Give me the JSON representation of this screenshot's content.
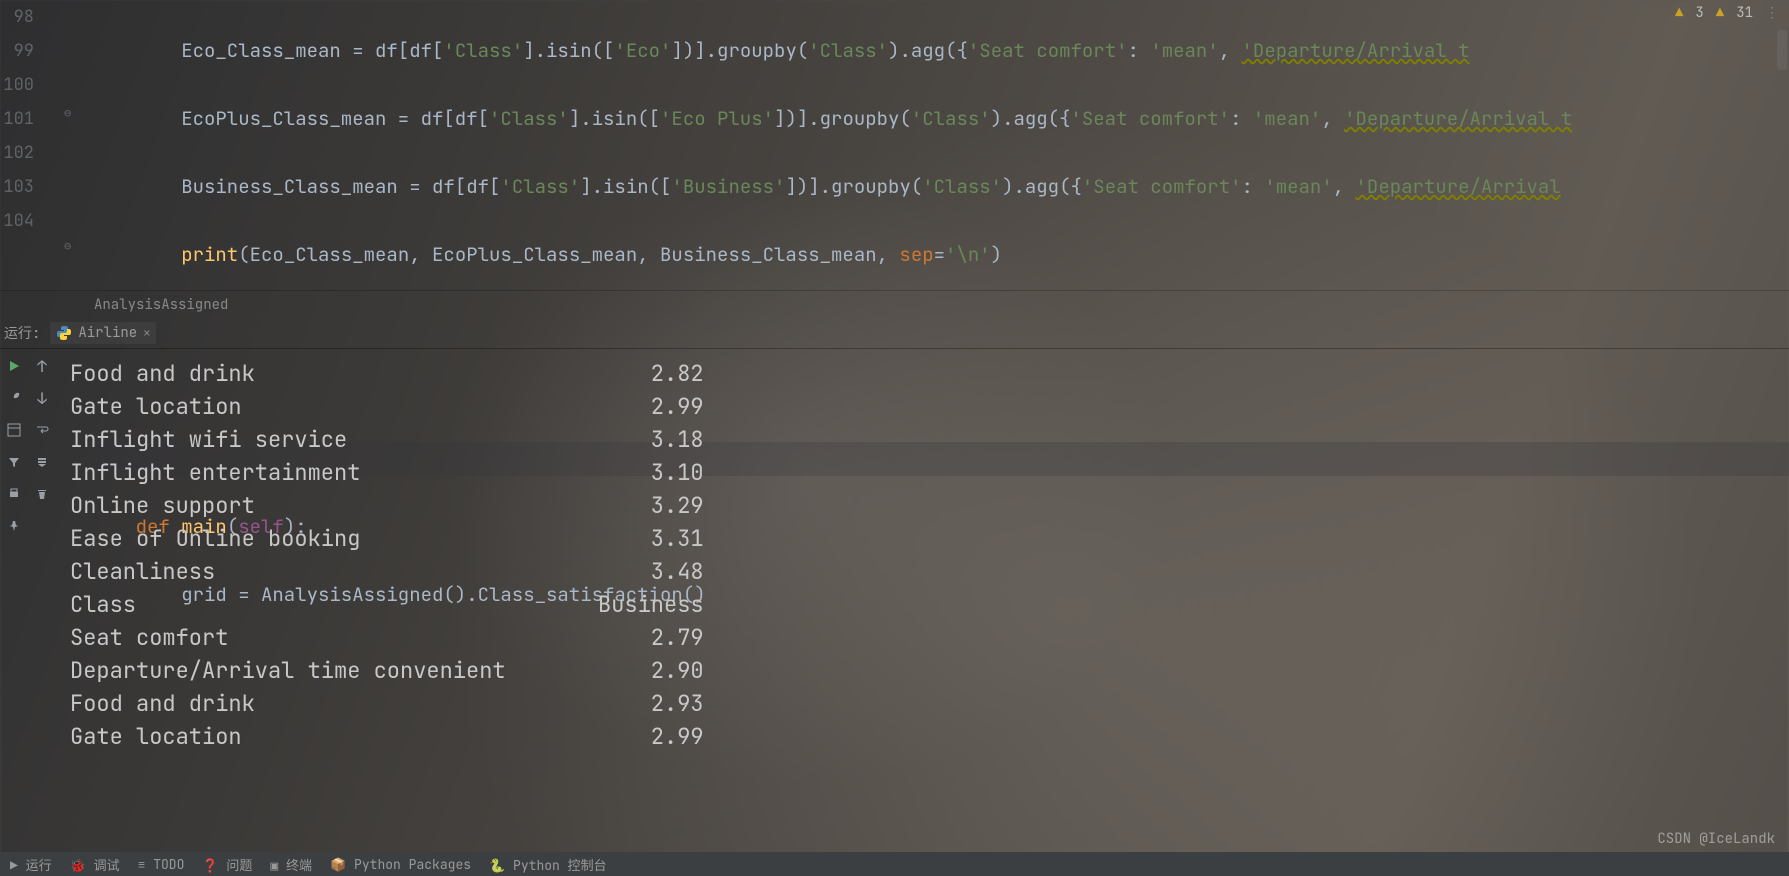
{
  "editor": {
    "line_start": 98,
    "lines": {
      "l98": {
        "var": "Eco_Class_mean",
        "eq": " = df[df[",
        "s1": "'Class'",
        "m1": "].isin([",
        "s2": "'Eco'",
        "m2": "])].groupby(",
        "s3": "'Class'",
        "m3": ").agg({",
        "s4": "'Seat comfort'",
        "m4": ": ",
        "s5": "'mean'",
        "m5": ", ",
        "s6": "'Departure/Arrival t"
      },
      "l99": {
        "var": "EcoPlus_Class_mean",
        "eq": " = df[df[",
        "s1": "'Class'",
        "m1": "].isin([",
        "s2": "'Eco Plus'",
        "m2": "])].groupby(",
        "s3": "'Class'",
        "m3": ").agg({",
        "s4": "'Seat comfort'",
        "m4": ": ",
        "s5": "'mean'",
        "m5": ", ",
        "s6": "'Departure/Arrival t"
      },
      "l100": {
        "var": "Business_Class_mean",
        "eq": " = df[df[",
        "s1": "'Class'",
        "m1": "].isin([",
        "s2": "'Business'",
        "m2": "])].groupby(",
        "s3": "'Class'",
        "m3": ").agg({",
        "s4": "'Seat comfort'",
        "m4": ": ",
        "s5": "'mean'",
        "m5": ", ",
        "s6": "'Departure/Arrival"
      },
      "l101": {
        "fn": "print",
        "args": "(Eco_Class_mean, EcoPlus_Class_mean, Business_Class_mean, ",
        "kw": "sep",
        "eq2": "=",
        "s1": "'\\n'",
        "close": ")"
      },
      "l105": {
        "def": "def ",
        "name": "main",
        "open": "(",
        "self": "self",
        "close": "):"
      },
      "l106": {
        "text1": "grid = AnalysisAssigned().Class_satisfaction()"
      }
    },
    "line_numbers": [
      "98",
      "99",
      "100",
      "101",
      "102",
      "103",
      "104"
    ],
    "breadcrumb": "AnalysisAssigned",
    "inspections": {
      "w1": "3",
      "w2": "31"
    }
  },
  "run": {
    "label": "运行:",
    "tab": "Airline",
    "output_rows": [
      {
        "k": "Food and drink",
        "v": "2.82"
      },
      {
        "k": "Gate location",
        "v": "2.99"
      },
      {
        "k": "Inflight wifi service",
        "v": "3.18"
      },
      {
        "k": "Inflight entertainment",
        "v": "3.10"
      },
      {
        "k": "Online support",
        "v": "3.29"
      },
      {
        "k": "Ease of Online booking",
        "v": "3.31"
      },
      {
        "k": "Cleanliness",
        "v": "3.48"
      },
      {
        "k": "Class",
        "v": "Business"
      },
      {
        "k": "Seat comfort",
        "v": "2.79"
      },
      {
        "k": "Departure/Arrival time convenient",
        "v": "2.90"
      },
      {
        "k": "Food and drink",
        "v": "2.93"
      },
      {
        "k": "Gate location",
        "v": "2.99"
      }
    ]
  },
  "statusbar": {
    "items": [
      "▶ 运行",
      "🐞 调试",
      "≡ TODO",
      "❓ 问题",
      "▣ 终端",
      "📦 Python Packages",
      "🐍 Python 控制台"
    ]
  },
  "watermark": "CSDN @IceLandk"
}
